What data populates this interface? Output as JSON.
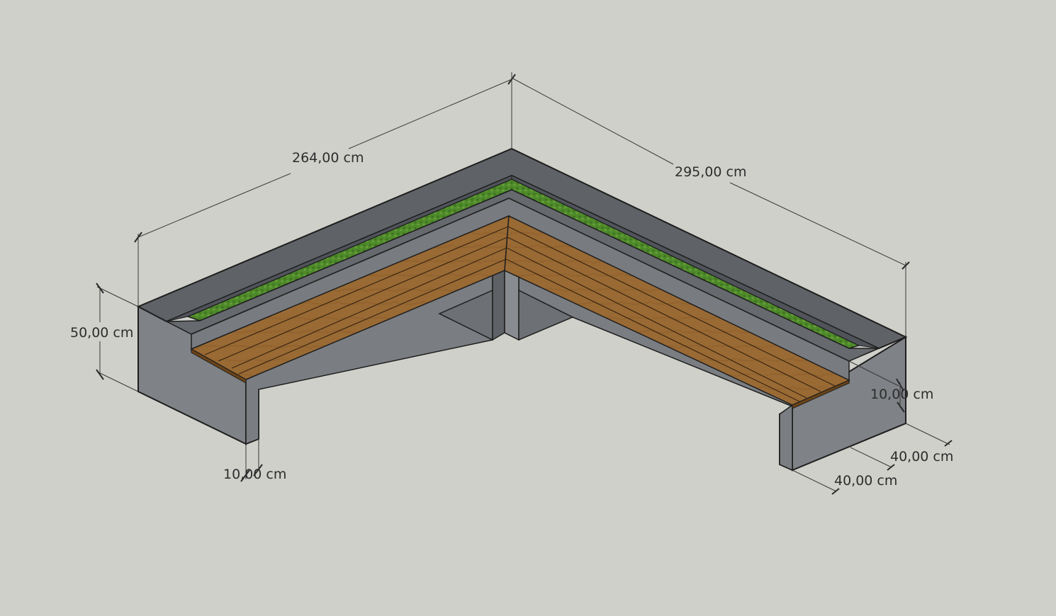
{
  "colors": {
    "background": "#cfd0ca",
    "concrete_top": "#6e7175",
    "concrete_side": "#85888c",
    "concrete_dark": "#5a5d61",
    "edge": "#1e1e1e",
    "planting": "#4e8a2a",
    "wood": "#9a6a34",
    "wood_dark": "#7a4f22"
  },
  "dimensions": {
    "length_left": "264,00 cm",
    "length_right": "295,00 cm",
    "height": "50,00 cm",
    "wall_thickness_left": "10,00 cm",
    "wall_thickness_right": "10,00 cm",
    "depth_outer": "40,00 cm",
    "depth_inner": "40,00 cm"
  }
}
